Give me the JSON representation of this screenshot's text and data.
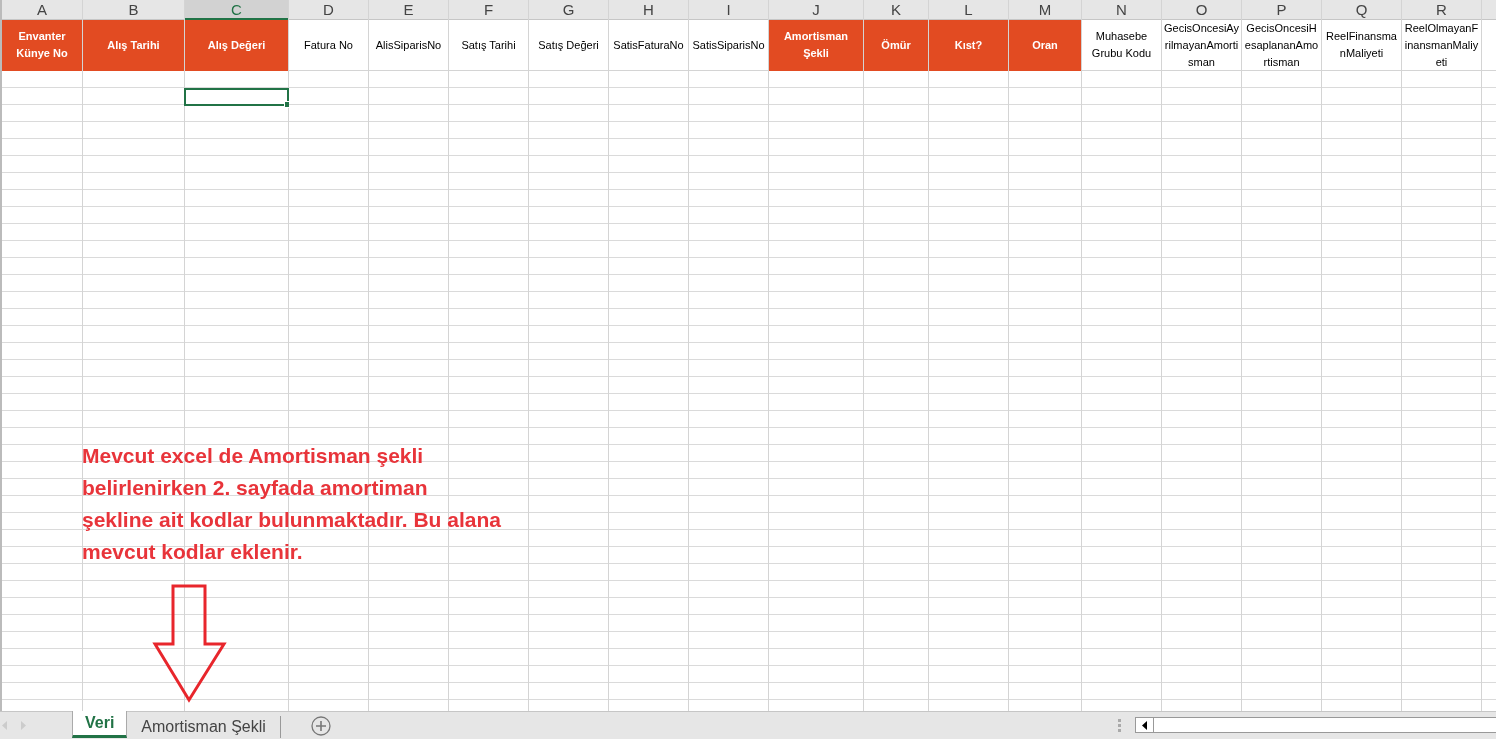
{
  "columns": [
    {
      "letter": "A",
      "header": "Envanter Künye No",
      "highlighted": true,
      "selected": false
    },
    {
      "letter": "B",
      "header": "Alış Tarihi",
      "highlighted": true,
      "selected": false
    },
    {
      "letter": "C",
      "header": "Alış Değeri",
      "highlighted": true,
      "selected": true
    },
    {
      "letter": "D",
      "header": "Fatura No",
      "highlighted": false,
      "selected": false
    },
    {
      "letter": "E",
      "header": "AlisSiparisNo",
      "highlighted": false,
      "selected": false
    },
    {
      "letter": "F",
      "header": "Satış Tarihi",
      "highlighted": false,
      "selected": false
    },
    {
      "letter": "G",
      "header": "Satış Değeri",
      "highlighted": false,
      "selected": false
    },
    {
      "letter": "H",
      "header": "SatisFaturaNo",
      "highlighted": false,
      "selected": false
    },
    {
      "letter": "I",
      "header": "SatisSiparisNo",
      "highlighted": false,
      "selected": false
    },
    {
      "letter": "J",
      "header": "Amortisman Şekli",
      "highlighted": true,
      "selected": false
    },
    {
      "letter": "K",
      "header": "Ömür",
      "highlighted": true,
      "selected": false
    },
    {
      "letter": "L",
      "header": "Kıst?",
      "highlighted": true,
      "selected": false
    },
    {
      "letter": "M",
      "header": "Oran",
      "highlighted": true,
      "selected": false
    },
    {
      "letter": "N",
      "header": "Muhasebe Grubu Kodu",
      "highlighted": false,
      "selected": false
    },
    {
      "letter": "O",
      "header": "GecisOncesiAyrilmayanAmortisman",
      "highlighted": false,
      "selected": false
    },
    {
      "letter": "P",
      "header": "GecisOncesiHesaplananAmortisman",
      "highlighted": false,
      "selected": false
    },
    {
      "letter": "Q",
      "header": "ReelFinansmanMaliyeti",
      "highlighted": false,
      "selected": false
    },
    {
      "letter": "R",
      "header": "ReelOlmayanFinansmanMaliyeti",
      "highlighted": false,
      "selected": false
    }
  ],
  "annotation": {
    "lines": [
      "Mevcut excel de Amortisman şekli",
      "belirlenirken 2. sayfada amortiman",
      "şekline ait kodlar bulunmaktadır. Bu alana",
      "mevcut kodlar eklenir."
    ]
  },
  "tabs": [
    {
      "label": "Veri",
      "selected": true
    },
    {
      "label": "Amortisman Şekli",
      "selected": false
    }
  ]
}
